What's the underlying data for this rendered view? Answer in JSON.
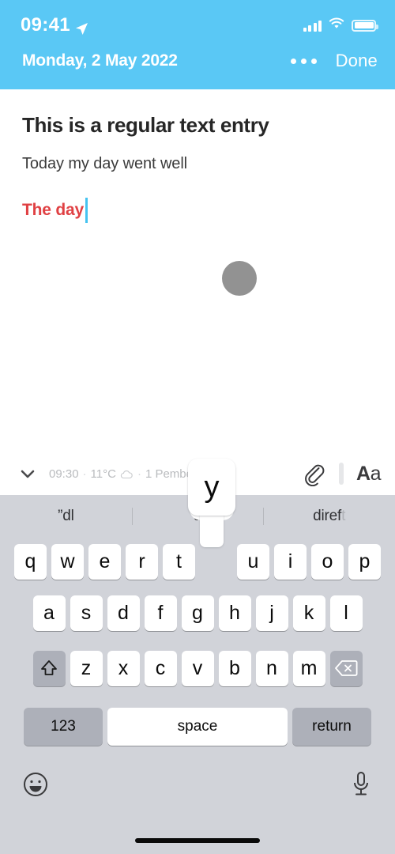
{
  "status_bar": {
    "time": "09:41",
    "location_icon": "location-arrow-icon",
    "signal_icon": "cellular-signal-icon",
    "wifi_icon": "wifi-icon",
    "battery_icon": "battery-icon"
  },
  "nav_bar": {
    "title": "Monday, 2 May 2022",
    "more_icon": "more-dots-icon",
    "done_label": "Done",
    "background_color": "#5ac8f5"
  },
  "note": {
    "title": "This is a regular text entry",
    "body": "Today my day went well",
    "highlighted_text": "The day",
    "highlight_color": "#e04043",
    "caret_color": "#45c3f0"
  },
  "meta_bar": {
    "collapse_icon": "chevron-down-icon",
    "time": "09:30",
    "separator": "·",
    "temperature": "11°C",
    "weather_icon": "cloud-icon",
    "location": "1 Pemberto...",
    "attach_icon": "paperclip-icon",
    "format_label_bold": "A",
    "format_label_regular": "a"
  },
  "keyboard": {
    "suggestions": [
      "”dl",
      "d",
      "diref"
    ],
    "suggestion_tail": "t",
    "popup_key": "y",
    "row1": [
      "q",
      "w",
      "e",
      "r",
      "t",
      "y",
      "u",
      "i",
      "o",
      "p"
    ],
    "row2": [
      "a",
      "s",
      "d",
      "f",
      "g",
      "h",
      "j",
      "k",
      "l"
    ],
    "row3": [
      "z",
      "x",
      "c",
      "v",
      "b",
      "n",
      "m"
    ],
    "shift_icon": "shift-arrow-icon",
    "backspace_icon": "backspace-delete-icon",
    "numbers_label": "123",
    "space_label": "space",
    "return_label": "return",
    "emoji_icon": "emoji-smiley-icon",
    "mic_icon": "microphone-icon",
    "background_color": "#d1d3d9"
  }
}
